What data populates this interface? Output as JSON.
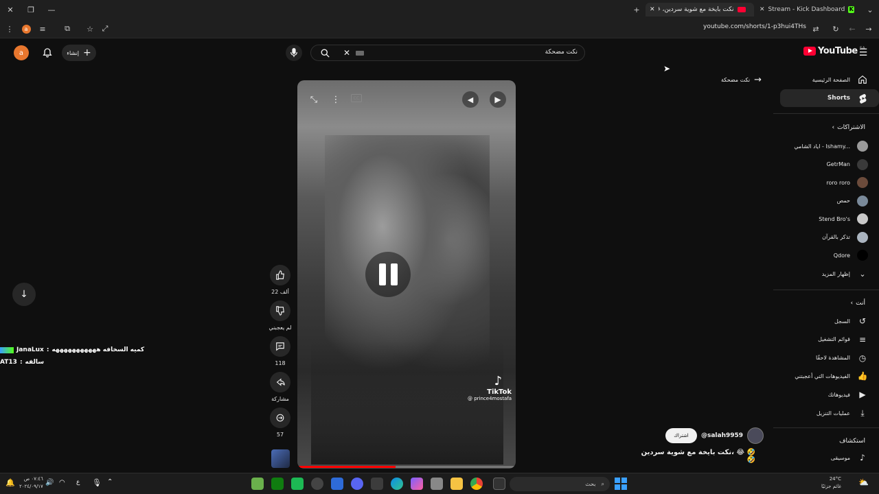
{
  "browser": {
    "tabs": [
      {
        "title": "Stream - Kick Dashboard"
      },
      {
        "title": "نكت بايخة مع شوية سردين، 😂..."
      }
    ],
    "url": "youtube.com/shorts/1-p3hui4THs"
  },
  "header": {
    "logo_text": "YouTube",
    "logo_region": "SA",
    "search_value": "نكت مضحكة",
    "create_label": "إنشاء",
    "avatar_letter": "a"
  },
  "back_link": "نكت مضحكة",
  "sidebar": {
    "home_label": "الصفحة الرئيسية",
    "shorts_label": "Shorts",
    "subscriptions_heading": "الاشتراكات",
    "subscriptions": [
      {
        "name": "اياد الشامي - Ishamy...",
        "color": "#9a9a9a"
      },
      {
        "name": "GetrMan",
        "color": "#3a3a3a"
      },
      {
        "name": "roro roro",
        "color": "#6b4b3b"
      },
      {
        "name": "حمص",
        "color": "#7a8a9a"
      },
      {
        "name": "Stend Bro's",
        "color": "#c9c9c9"
      },
      {
        "name": "تذكر بالقرآن",
        "color": "#aab4bf"
      },
      {
        "name": "Qdore",
        "color": "#000000"
      }
    ],
    "show_more_label": "إظهار المزيد",
    "you_heading": "أنت",
    "you_items": [
      {
        "label": "السجل",
        "icon": "history-icon"
      },
      {
        "label": "قوائم التشغيل",
        "icon": "playlist-icon"
      },
      {
        "label": "المشاهدة لاحقًا",
        "icon": "clock-icon"
      },
      {
        "label": "الفيديوهات التي أعجبتني",
        "icon": "like-icon"
      },
      {
        "label": "فيديوهاتك",
        "icon": "video-icon"
      },
      {
        "label": "عمليات التنزيل",
        "icon": "download-icon"
      }
    ],
    "explore_heading": "استكشاف",
    "explore_items": [
      {
        "label": "موسيقى",
        "icon": "music-icon"
      }
    ]
  },
  "video": {
    "watermark_brand": "TikTok",
    "watermark_handle": "@ prince4mostafa",
    "progress": 0.45
  },
  "actions": {
    "like_count": "22 ألف",
    "dislike_label": "لم يعجبني",
    "comment_count": "118",
    "share_label": "مشاركة",
    "remix_count": "57"
  },
  "channel": {
    "handle": "@salah9959",
    "subscribe_label": "اشتراك",
    "title": "نكت بايخة مع شوية سردين، 😂 🤣 🤣"
  },
  "overlay_chat": [
    {
      "user": "JanaLux",
      "message": "كميه السخافه هههههههههههه"
    },
    {
      "user": "AT13",
      "message": "سالفه"
    }
  ],
  "taskbar": {
    "time": "٠٧:٤٦ ص",
    "date": "٢٠٢٤/٠٩/١٧",
    "search_placeholder": "بحث",
    "weather_temp": "24°C",
    "weather_desc": "غائم جزئيًا",
    "lang": "ع"
  },
  "colors": {
    "yt_red": "#ff0033",
    "bg": "#0f0f0f",
    "subscribe_bg": "#f1f1f1",
    "progress_red": "#ff0000"
  }
}
